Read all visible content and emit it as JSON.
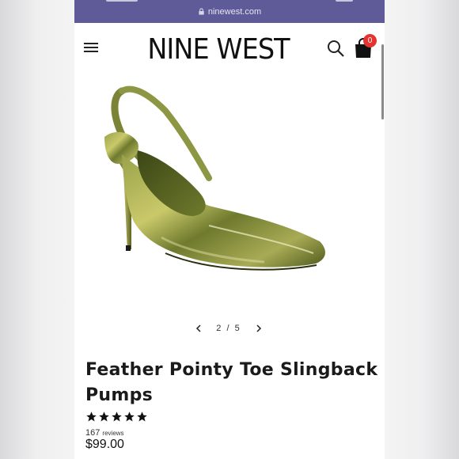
{
  "browser": {
    "url": "ninewest.com"
  },
  "header": {
    "logo": "NINE WEST",
    "cart_count": "0"
  },
  "icons": {
    "menu": "hamburger-menu-icon",
    "search": "search-icon",
    "bag": "shopping-bag-icon",
    "lock": "lock-icon"
  },
  "gallery": {
    "pager": "2 / 5",
    "current": 2,
    "total": 5
  },
  "product": {
    "title_line1": "Feather Pointy Toe Slingback",
    "title_line2": "Pumps",
    "rating_stars": 5,
    "review_count": "167",
    "review_word": "reviews",
    "price": "$99.00"
  },
  "colors": {
    "url_bar": "#5f5a98",
    "badge": "#e3342f",
    "shoe": "#6f7a2e"
  }
}
